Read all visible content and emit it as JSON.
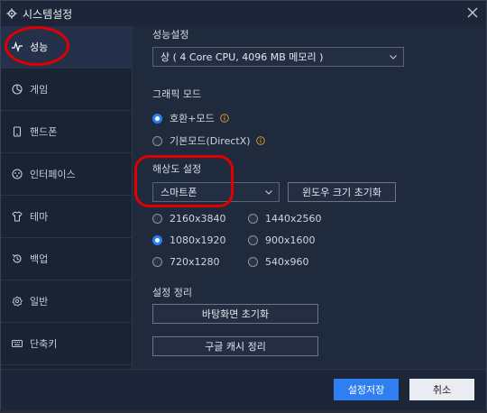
{
  "window": {
    "title": "시스템설정"
  },
  "sidebar": {
    "items": [
      {
        "label": "성능",
        "icon": "performance-icon",
        "active": true
      },
      {
        "label": "게임",
        "icon": "game-icon"
      },
      {
        "label": "핸드폰",
        "icon": "phone-icon"
      },
      {
        "label": "인터페이스",
        "icon": "interface-icon"
      },
      {
        "label": "테마",
        "icon": "theme-icon"
      },
      {
        "label": "백업",
        "icon": "backup-icon"
      },
      {
        "label": "일반",
        "icon": "general-icon"
      },
      {
        "label": "단축키",
        "icon": "keyboard-icon"
      }
    ]
  },
  "performance": {
    "title": "성능설정",
    "select_value": "상 ( 4 Core CPU, 4096 MB 메모리 )"
  },
  "graphics": {
    "title": "그래픽 모드",
    "options": [
      {
        "label": "호환+모드",
        "selected": true
      },
      {
        "label": "기본모드(DirectX)",
        "selected": false
      }
    ]
  },
  "resolution": {
    "title": "해상도 설정",
    "select_value": "스마트폰",
    "reset_button": "윈도우 크기 초기화",
    "options": [
      {
        "label": "2160x3840",
        "selected": false
      },
      {
        "label": "1440x2560",
        "selected": false
      },
      {
        "label": "1080x1920",
        "selected": true
      },
      {
        "label": "900x1600",
        "selected": false
      },
      {
        "label": "720x1280",
        "selected": false
      },
      {
        "label": "540x960",
        "selected": false
      }
    ]
  },
  "cleanup": {
    "title": "설정 정리",
    "wallpaper_reset": "바탕화면 초기화",
    "google_cache": "구글 캐시 정리"
  },
  "footer": {
    "save": "설정저장",
    "cancel": "취소"
  },
  "colors": {
    "accent": "#2f7ff0",
    "annotation": "#e00000"
  }
}
